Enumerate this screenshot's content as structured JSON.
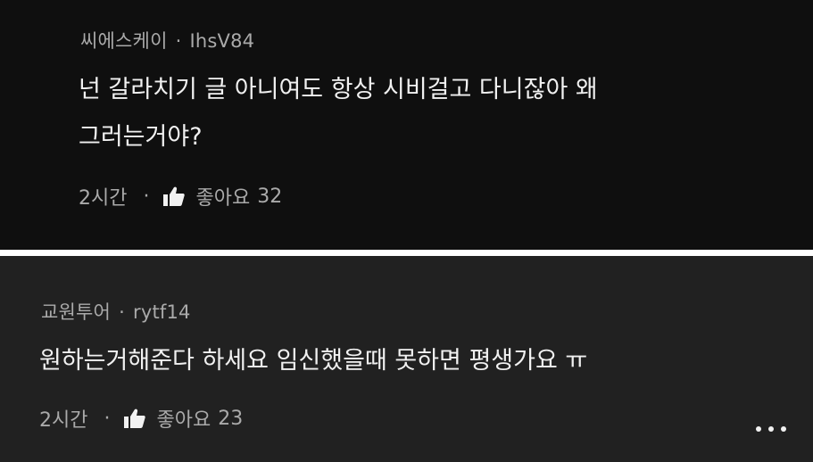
{
  "comments": [
    {
      "author": "씨에스케이",
      "handle": "IhsV84",
      "separator": "·",
      "lines": [
        "넌 갈라치기 글 아니여도 항상 시비걸고 다니잖아 왜",
        "그러는거야?"
      ],
      "time": "2시간",
      "like_label": "좋아요",
      "like_count": "32"
    },
    {
      "author": "교원투어",
      "handle": "rytf14",
      "separator": "·",
      "lines": [
        "원하는거해준다 하세요 임신했을때 못하면 평생가요 ㅠ"
      ],
      "time": "2시간",
      "like_label": "좋아요",
      "like_count": "23"
    }
  ],
  "icons": {
    "like": "thumbs-up-icon",
    "more": "more-horizontal-icon"
  },
  "colors": {
    "background_top": "#0f0f0f",
    "background_bottom": "#212121",
    "text_primary": "#f1f1f1",
    "text_secondary": "#aaaaaa"
  }
}
